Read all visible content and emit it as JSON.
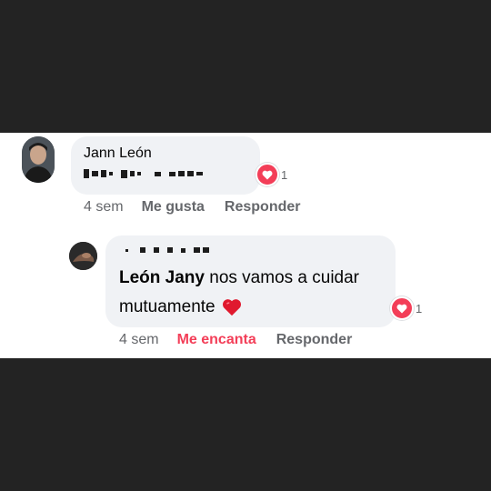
{
  "comment": {
    "author": "Jann León",
    "text_redacted": true,
    "reaction": {
      "icon": "heart-reaction-icon",
      "count": "1"
    },
    "time": "4 sem",
    "like_label": "Me gusta",
    "reply_label": "Responder"
  },
  "reply": {
    "author_redacted": true,
    "mention": "León Jany",
    "text": " nos vamos a cuidar mutuamente ",
    "emoji": "red-heart-emoji",
    "reaction": {
      "icon": "heart-reaction-icon",
      "count": "1"
    },
    "time": "4 sem",
    "love_label": "Me encanta",
    "reply_label": "Responder"
  },
  "colors": {
    "love_red": "#f33e58",
    "bubble": "#f0f2f5",
    "meta_gray": "#65676b",
    "backdrop": "#232323"
  }
}
